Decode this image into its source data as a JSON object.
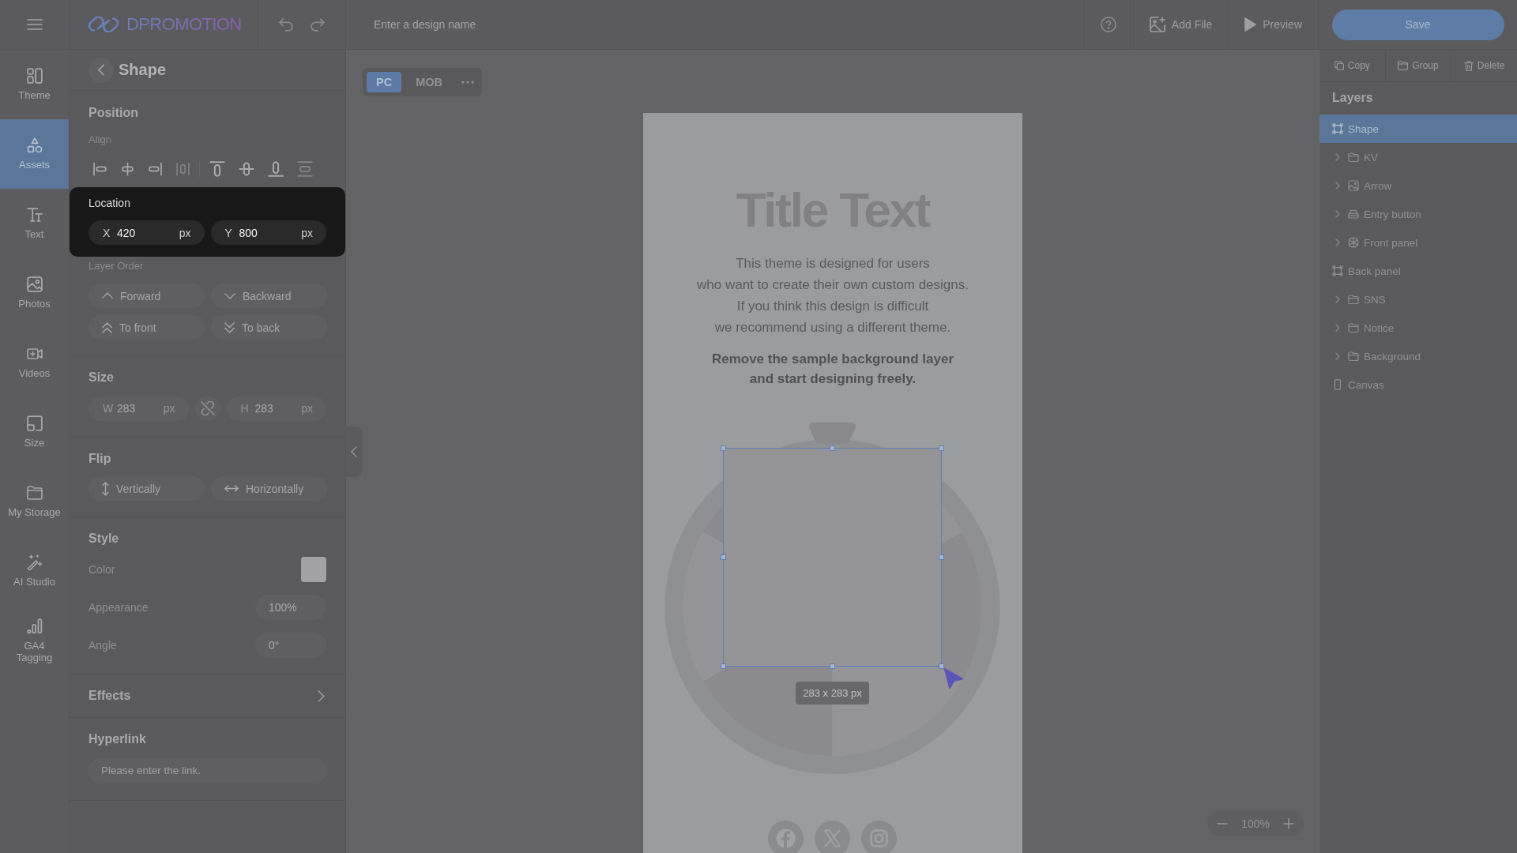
{
  "top_bar": {
    "logo": "DPROMOTION",
    "design_name": {
      "placeholder": "Enter a design name"
    },
    "buttons": [
      "Add File",
      "Preview"
    ],
    "save": "Save"
  },
  "sidebar": {
    "items": [
      {
        "label": "Theme",
        "selected": false
      },
      {
        "label": "Assets",
        "selected": true
      },
      {
        "label": "Text",
        "selected": false
      },
      {
        "label": "Photos",
        "selected": false
      },
      {
        "label": "Videos",
        "selected": false
      },
      {
        "label": "Size",
        "selected": false
      },
      {
        "label": "My Storage",
        "selected": false
      },
      {
        "label": "AI Studio",
        "selected": false
      },
      {
        "label": "GA4\nTagging",
        "selected": false
      }
    ]
  },
  "properties": {
    "title": "Shape",
    "position": {
      "heading": "Position",
      "align_label": "Align",
      "align_tools": [
        {
          "disabled": false
        },
        {
          "disabled": false
        },
        {
          "disabled": false
        },
        {
          "disabled": true
        },
        {
          "disabled": false
        },
        {
          "disabled": false
        },
        {
          "disabled": false
        },
        {
          "disabled": true
        }
      ],
      "location": {
        "label": "Location",
        "highlighted": true,
        "fields": [
          {
            "label": "X",
            "value": "420",
            "unit": "px"
          },
          {
            "label": "Y",
            "value": "800",
            "unit": "px"
          }
        ]
      },
      "order_label": "Layer Order",
      "order_buttons": [
        "Forward",
        "Backward",
        "To front",
        "To back"
      ]
    },
    "size": {
      "heading": "Size",
      "fields": [
        {
          "label": "W",
          "value": "283",
          "unit": "px"
        },
        {
          "label": "H",
          "value": "283",
          "unit": "px"
        }
      ],
      "ratio_locked": false
    },
    "flip": {
      "heading": "Flip",
      "buttons": [
        "Vertically",
        "Horizontally"
      ]
    },
    "style": {
      "heading": "Style",
      "rows": [
        {
          "kind": "swatch",
          "label": "Color",
          "color": "#a3a3a5"
        },
        {
          "kind": "field",
          "label": "Appearance",
          "value": "100%"
        },
        {
          "kind": "field",
          "label": "Angle",
          "value": "0°"
        }
      ]
    },
    "effects": {
      "heading": "Effects"
    },
    "hyperlink": {
      "heading": "Hyperlink",
      "placeholder": "Please enter the link."
    }
  },
  "canvas": {
    "devices": [
      {
        "label": "PC",
        "selected": true
      },
      {
        "label": "MOB",
        "selected": false
      }
    ],
    "artboard": {
      "title": "Title Text",
      "body": "This theme is designed for users\nwho want to create their own custom designs.\nIf you think this design is difficult\nwe recommend using a different theme.",
      "note": "Remove the sample background layer\nand start designing freely."
    },
    "selection": {
      "size": "283 x 283 px"
    },
    "zoom": "100%"
  },
  "layers": {
    "actions": [
      "Copy",
      "Group",
      "Delete"
    ],
    "title": "Layers",
    "items": [
      {
        "label": "Shape",
        "kind": "shape",
        "selected": true
      },
      {
        "label": "KV",
        "kind": "group",
        "selected": false,
        "expanded": false
      },
      {
        "label": "Arrow",
        "kind": "image",
        "selected": false,
        "expanded": false
      },
      {
        "label": "Entry button",
        "kind": "button",
        "selected": false,
        "expanded": false
      },
      {
        "label": "Front panel",
        "kind": "wheel",
        "selected": false,
        "expanded": false
      },
      {
        "label": "Back panel",
        "kind": "shape",
        "selected": false
      },
      {
        "label": "SNS",
        "kind": "group",
        "selected": false,
        "expanded": false
      },
      {
        "label": "Notice",
        "kind": "group",
        "selected": false,
        "expanded": false
      },
      {
        "label": "Background",
        "kind": "group",
        "selected": false,
        "expanded": false
      },
      {
        "label": "Canvas",
        "kind": "canvas",
        "selected": false
      }
    ]
  }
}
